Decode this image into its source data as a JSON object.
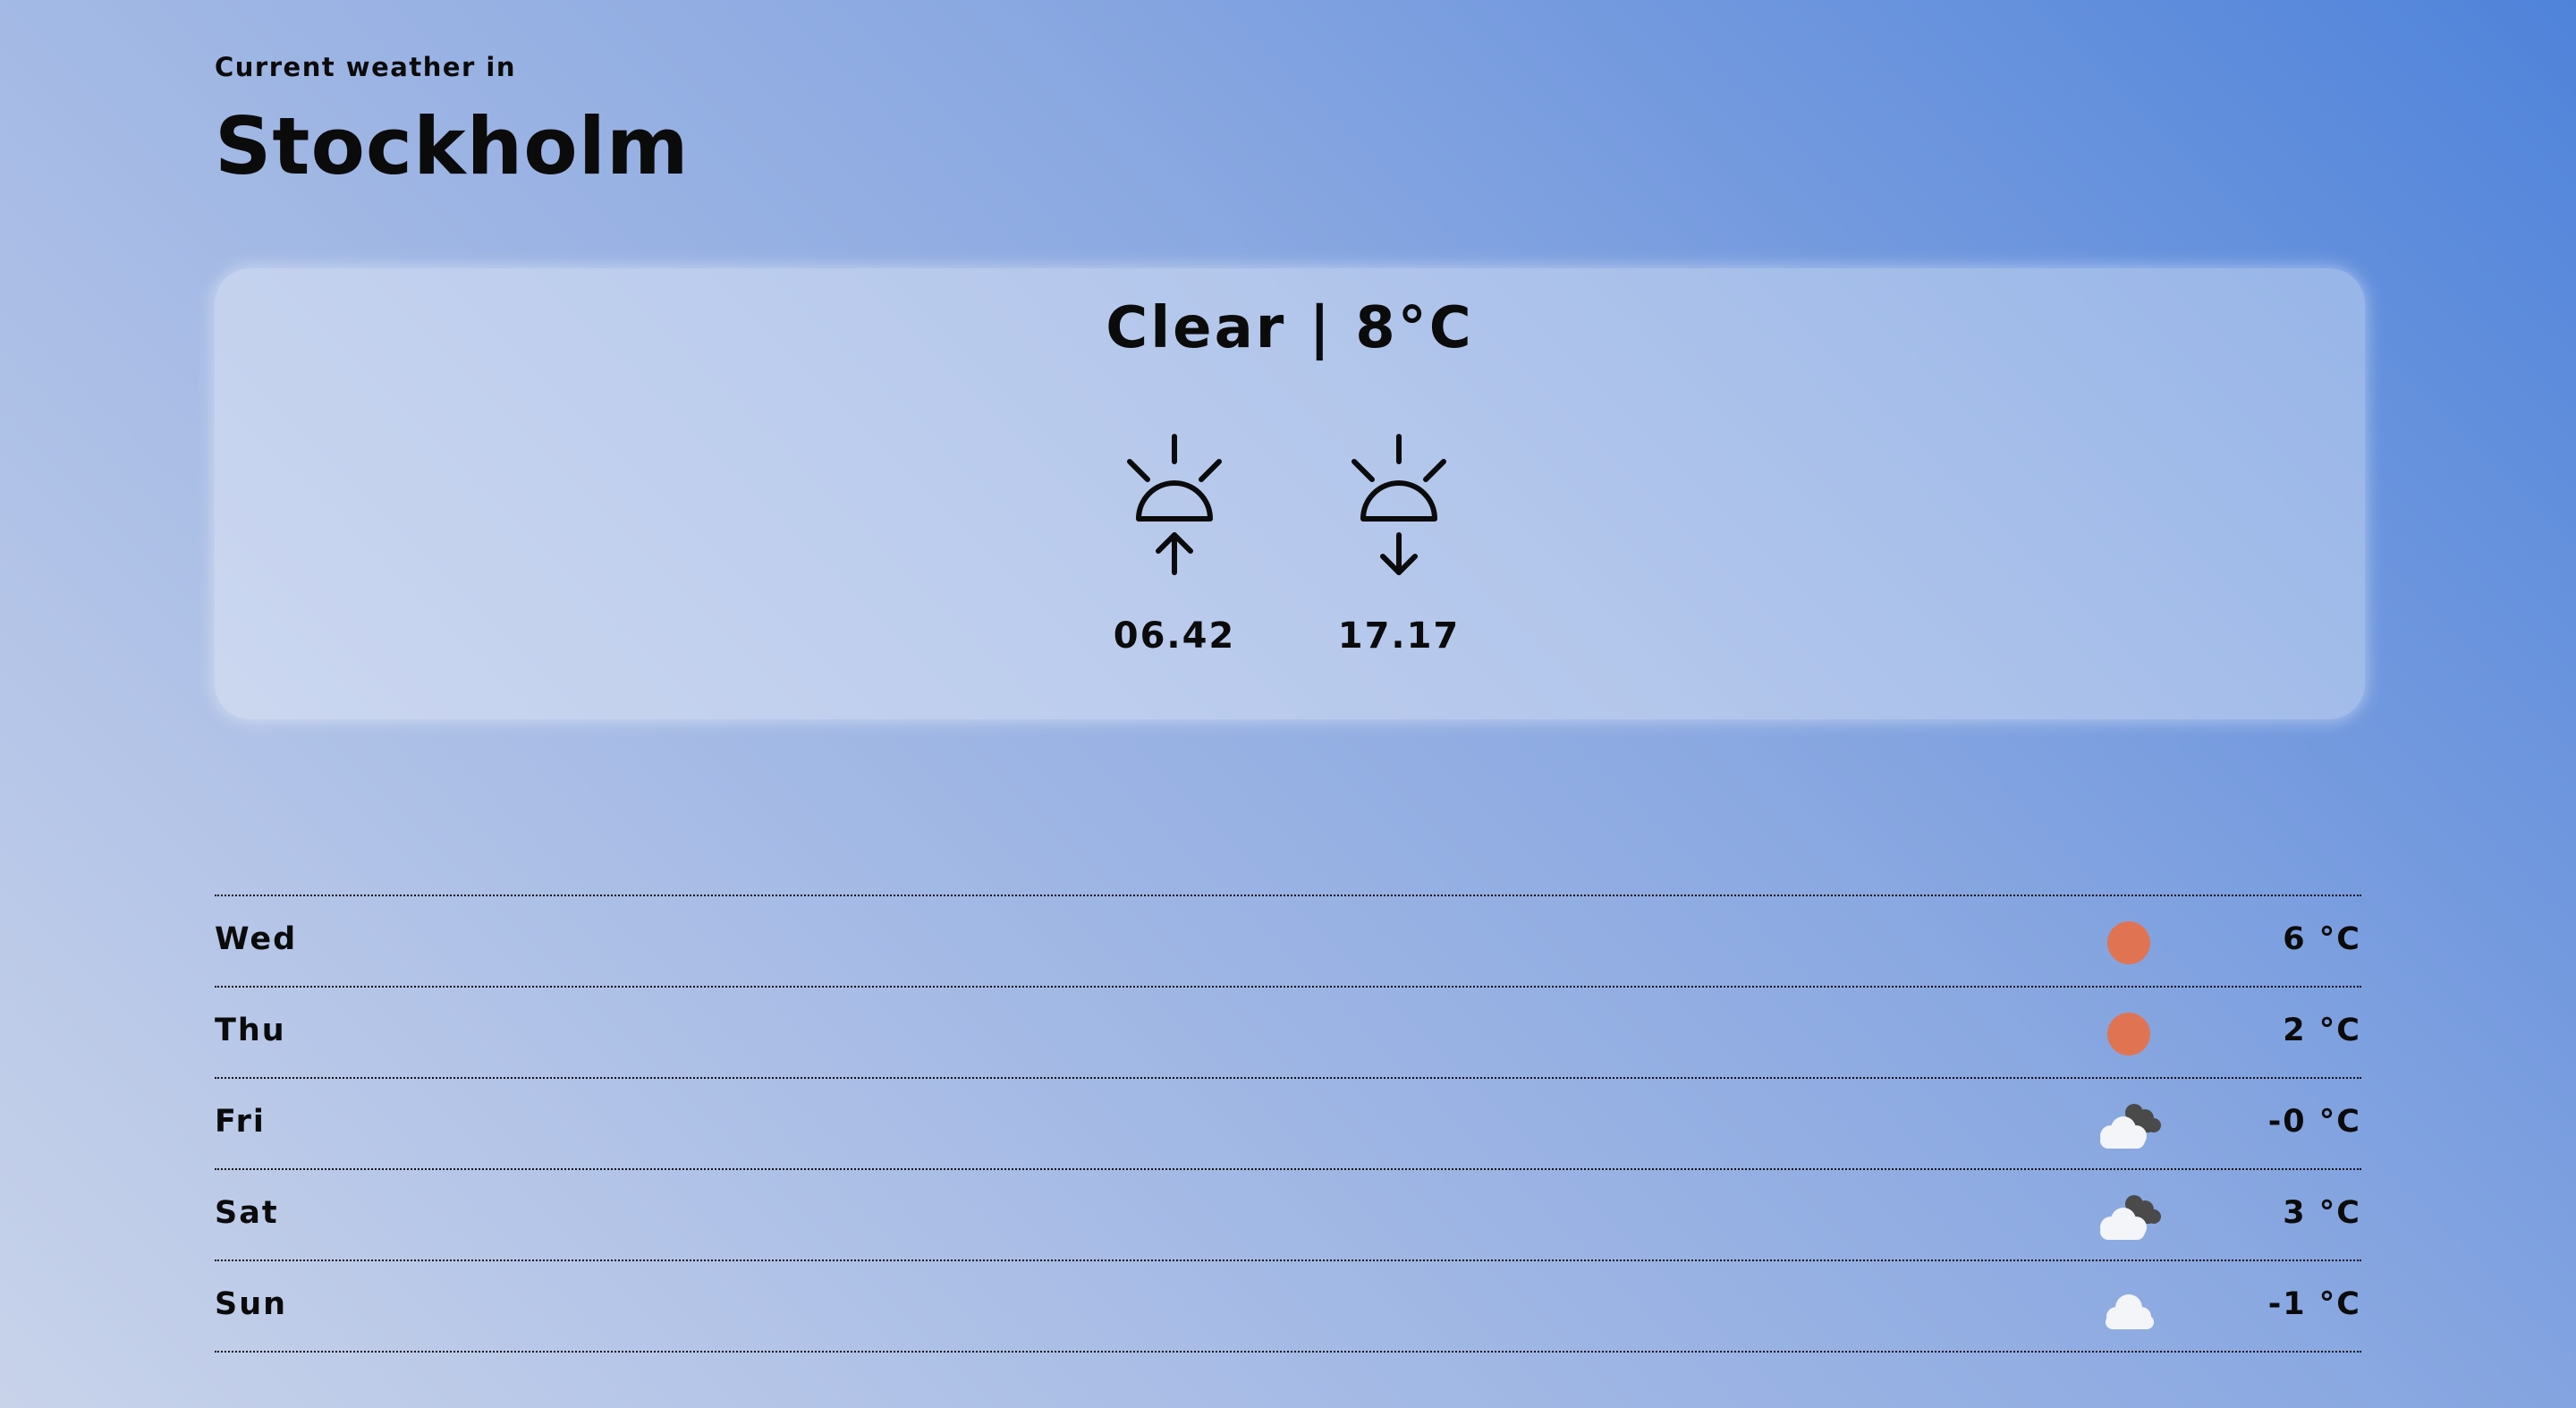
{
  "header": {
    "eyebrow": "Current weather in",
    "city": "Stockholm"
  },
  "current": {
    "summary": "Clear | 8°C",
    "sunrise": {
      "icon": "sunrise-icon",
      "time": "06.42"
    },
    "sunset": {
      "icon": "sunset-icon",
      "time": "17.17"
    }
  },
  "forecast": [
    {
      "day": "Wed",
      "icon": "sun-icon",
      "temp": "6 °C"
    },
    {
      "day": "Thu",
      "icon": "sun-icon",
      "temp": "2 °C"
    },
    {
      "day": "Fri",
      "icon": "cloud-dark-icon",
      "temp": "-0 °C"
    },
    {
      "day": "Sat",
      "icon": "cloud-dark-icon",
      "temp": "3 °C"
    },
    {
      "day": "Sun",
      "icon": "cloud-icon",
      "temp": "-1 °C"
    }
  ],
  "colors": {
    "sun": "#e07452",
    "cloud_light": "#f4f5f8",
    "cloud_dark": "#4a4a4a",
    "text": "#0b0b0b"
  }
}
